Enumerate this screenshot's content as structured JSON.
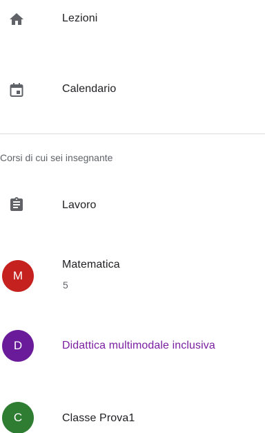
{
  "nav": {
    "lessons": {
      "label": "Lezioni",
      "icon": "home-icon"
    },
    "calendar": {
      "label": "Calendario",
      "icon": "calendar-icon"
    }
  },
  "section": {
    "header": "Corsi di cui sei insegnante"
  },
  "work": {
    "label": "Lavoro",
    "icon": "assignment-icon"
  },
  "courses": [
    {
      "initial": "M",
      "name": "Matematica",
      "subtitle": "5",
      "avatar_color": "#c5221f",
      "name_color": "#202124"
    },
    {
      "initial": "D",
      "name": "Didattica multimodale inclusiva",
      "subtitle": "",
      "avatar_color": "#6a1b9a",
      "name_color": "#7b1fa2"
    },
    {
      "initial": "C",
      "name": "Classe Prova1",
      "subtitle": "",
      "avatar_color": "#2e7d32",
      "name_color": "#202124"
    }
  ],
  "colors": {
    "icon_gray": "#5f6368",
    "text": "#202124",
    "divider": "#dadce0"
  }
}
